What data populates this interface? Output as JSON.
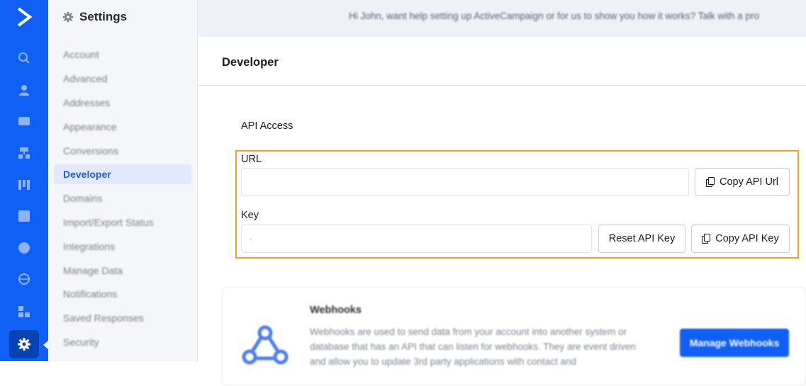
{
  "settings": {
    "title": "Settings",
    "nav": [
      {
        "label": "Account",
        "active": false
      },
      {
        "label": "Advanced",
        "active": false
      },
      {
        "label": "Addresses",
        "active": false
      },
      {
        "label": "Appearance",
        "active": false
      },
      {
        "label": "Conversions",
        "active": false
      },
      {
        "label": "Developer",
        "active": true
      },
      {
        "label": "Domains",
        "active": false
      },
      {
        "label": "Import/Export Status",
        "active": false
      },
      {
        "label": "Integrations",
        "active": false
      },
      {
        "label": "Manage Data",
        "active": false
      },
      {
        "label": "Notifications",
        "active": false
      },
      {
        "label": "Saved Responses",
        "active": false
      },
      {
        "label": "Security",
        "active": false
      }
    ]
  },
  "banner": {
    "text": "Hi John, want help setting up ActiveCampaign or for us to show you how it works? Talk with a pro"
  },
  "page": {
    "title": "Developer"
  },
  "api_access": {
    "heading": "API Access",
    "url_label": "URL",
    "url_value": "",
    "copy_url_button": "Copy API Url",
    "key_label": "Key",
    "key_value": "·",
    "reset_key_button": "Reset API Key",
    "copy_key_button": "Copy API Key"
  },
  "webhooks": {
    "title": "Webhooks",
    "description": "Webhooks are used to send data from your account into another system or database that has an API that can listen for webhooks. They are event driven and allow you to update 3rd party applications with contact and",
    "button": "Manage Webhooks"
  },
  "colors": {
    "brand_blue": "#1060f5",
    "highlight_orange": "#f0a22e",
    "active_nav_bg": "#e2e9fb"
  },
  "icons": {
    "rail": [
      "activecampaign-logo-icon",
      "search-icon",
      "contacts-icon",
      "campaigns-icon",
      "automations-icon",
      "deals-icon",
      "reports-icon",
      "conversations-icon",
      "website-icon",
      "apps-icon",
      "gear-icon"
    ],
    "copy": "copy-icon",
    "webhooks": "webhooks-icon"
  }
}
